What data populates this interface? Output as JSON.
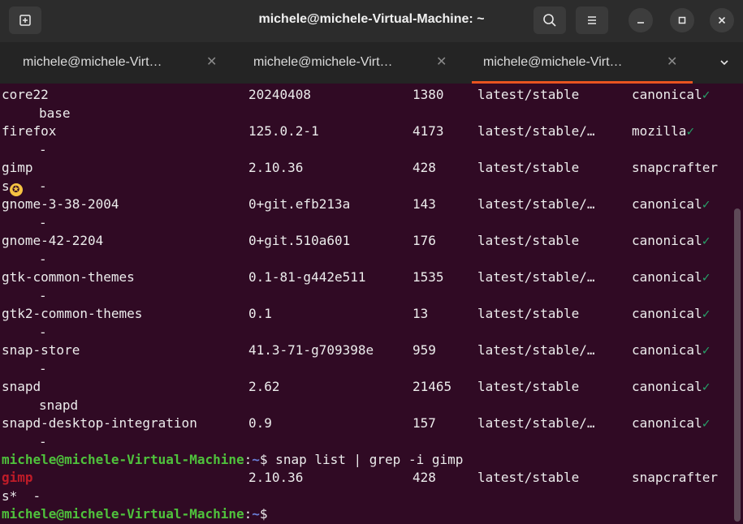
{
  "window": {
    "title": "michele@michele-Virtual-Machine: ~"
  },
  "tabs": [
    {
      "label": "michele@michele-Virt…",
      "active": false
    },
    {
      "label": "michele@michele-Virt…",
      "active": false
    },
    {
      "label": "michele@michele-Virt…",
      "active": true
    }
  ],
  "colors": {
    "terminal_bg": "#300a24",
    "accent": "#e95420",
    "prompt_user": "#4fc23c",
    "highlight": "#c01c28"
  },
  "terminal": {
    "rows": [
      {
        "name": "core22",
        "version": "20240408",
        "rev": "1380",
        "tracking": "latest/stable",
        "publisher": "canonical",
        "verified": true,
        "notes": "base"
      },
      {
        "name": "firefox",
        "version": "125.0.2-1",
        "rev": "4173",
        "tracking": "latest/stable/…",
        "publisher": "mozilla",
        "verified": true,
        "notes": "-"
      },
      {
        "name": "gimp",
        "version": "2.10.36",
        "rev": "428",
        "tracking": "latest/stable",
        "publisher": "snapcrafter",
        "publisher_wrap": "s",
        "starred": true,
        "notes": "-"
      },
      {
        "name": "gnome-3-38-2004",
        "version": "0+git.efb213a",
        "rev": "143",
        "tracking": "latest/stable/…",
        "publisher": "canonical",
        "verified": true,
        "notes": "-"
      },
      {
        "name": "gnome-42-2204",
        "version": "0+git.510a601",
        "rev": "176",
        "tracking": "latest/stable",
        "publisher": "canonical",
        "verified": true,
        "notes": "-"
      },
      {
        "name": "gtk-common-themes",
        "version": "0.1-81-g442e511",
        "rev": "1535",
        "tracking": "latest/stable/…",
        "publisher": "canonical",
        "verified": true,
        "notes": "-"
      },
      {
        "name": "gtk2-common-themes",
        "version": "0.1",
        "rev": "13",
        "tracking": "latest/stable",
        "publisher": "canonical",
        "verified": true,
        "notes": "-"
      },
      {
        "name": "snap-store",
        "version": "41.3-71-g709398e",
        "rev": "959",
        "tracking": "latest/stable/…",
        "publisher": "canonical",
        "verified": true,
        "notes": "-"
      },
      {
        "name": "snapd",
        "version": "2.62",
        "rev": "21465",
        "tracking": "latest/stable",
        "publisher": "canonical",
        "verified": true,
        "notes": "snapd"
      },
      {
        "name": "snapd-desktop-integration",
        "version": "0.9",
        "rev": "157",
        "tracking": "latest/stable/…",
        "publisher": "canonical",
        "verified": true,
        "notes": "-"
      }
    ],
    "verified_mark": "✓",
    "star_mark": "✪",
    "prompt_user": "michele@michele-Virtual-Machine",
    "prompt_sep": ":",
    "prompt_path": "~",
    "prompt_sigil": "$",
    "command": " snap list | grep -i gimp",
    "grep_result": {
      "name": "gimp",
      "version": "2.10.36",
      "rev": "428",
      "tracking": "latest/stable",
      "publisher": "snapcrafter",
      "wrap": "s*  -"
    }
  }
}
